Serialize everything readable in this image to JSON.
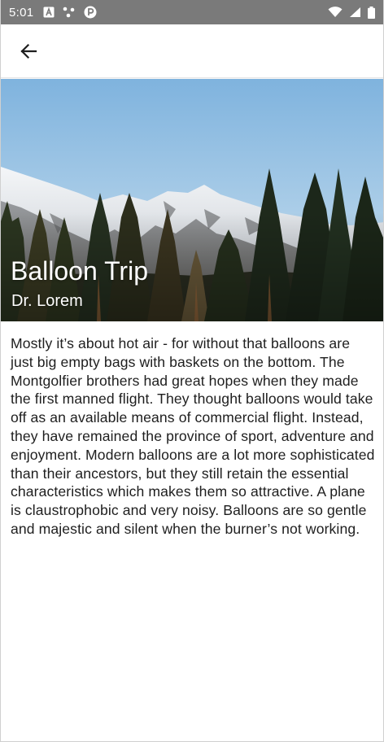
{
  "status_bar": {
    "time": "5:01",
    "left_icons": [
      "a-letter-icon",
      "dots-icon",
      "circle-p-icon"
    ],
    "right_icons": [
      "wifi-icon",
      "signal-icon",
      "battery-icon"
    ]
  },
  "app_bar": {
    "back_icon": "arrow-back-icon"
  },
  "hero": {
    "title": "Balloon Trip",
    "subtitle": "Dr. Lorem"
  },
  "article": {
    "text": "Mostly it’s about hot air - for without that balloons are just big empty bags with baskets on the bottom. The Montgolfier brothers had great hopes when they made the first manned flight. They thought balloons would take off as an available means of commercial flight. Instead, they have remained the province of sport, adventure and enjoyment. Modern balloons are a lot more sophisticated than their ancestors, but they still retain the essential characteristics which makes them so attractive. A plane is claustrophobic and very noisy. Balloons are so gentle and majestic and silent when the burner’s not working."
  },
  "colors": {
    "status_bar_bg": "#7a7a7a",
    "sky_top": "#7fb3de",
    "sky_bottom": "#cfe3f0",
    "forest_dark": "#1f2a1c",
    "text": "#1e1e1e"
  }
}
